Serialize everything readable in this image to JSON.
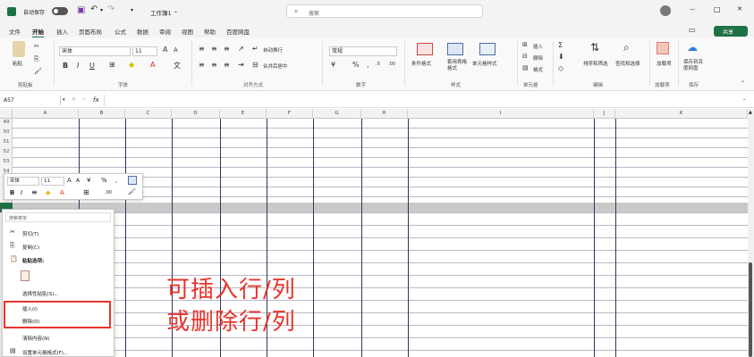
{
  "titlebar": {
    "autosave_label": "自动保存",
    "workbook_name": "工作簿1",
    "search_placeholder": "搜索",
    "minimize_icon": "—",
    "restore_icon": "□",
    "close_icon": "✕"
  },
  "menu": {
    "tabs": [
      "文件",
      "开始",
      "插入",
      "页面布局",
      "公式",
      "数据",
      "审阅",
      "视图",
      "帮助",
      "百度网盘"
    ],
    "active_tab": "开始",
    "share_label": "共享"
  },
  "ribbon": {
    "paste_label": "粘贴",
    "font_name": "宋体",
    "font_size": "11",
    "wrap_label": "自动换行",
    "merge_label": "合并后居中",
    "number_format": "常规",
    "cond_format_label": "条件格式",
    "table_format_label": "套用表格格式",
    "cell_style_label": "单元格样式",
    "insert_label": "插入",
    "delete_label": "删除",
    "format_label": "格式",
    "sort_label": "排序和筛选",
    "find_label": "查找和选择",
    "addin_label": "加载项",
    "save_baidu_label": "保存到百度网盘",
    "groups": [
      "剪贴板",
      "字体",
      "对齐方式",
      "数字",
      "样式",
      "单元格",
      "编辑",
      "加载项",
      "保存"
    ]
  },
  "formula_bar": {
    "name_box": "A57",
    "fx": "fx",
    "formula": ""
  },
  "columns": [
    "A",
    "B",
    "C",
    "D",
    "E",
    "F",
    "G",
    "H",
    "I",
    "J",
    "K"
  ],
  "rows": [
    "49",
    "50",
    "51",
    "52",
    "53",
    "54"
  ],
  "mini_toolbar": {
    "font_name": "宋体",
    "font_size": "11"
  },
  "context_menu": {
    "search_placeholder": "搜索菜单",
    "items": [
      "剪切(T)",
      "复制(C)",
      "粘贴选项:",
      "选择性粘贴(S)...",
      "插入(I)",
      "删除(D)",
      "清除内容(N)",
      "设置单元格格式(F)..."
    ]
  },
  "overlay": {
    "line1": "可插入行/列",
    "line2": "或删除行/列",
    "color": "#e8352c"
  }
}
